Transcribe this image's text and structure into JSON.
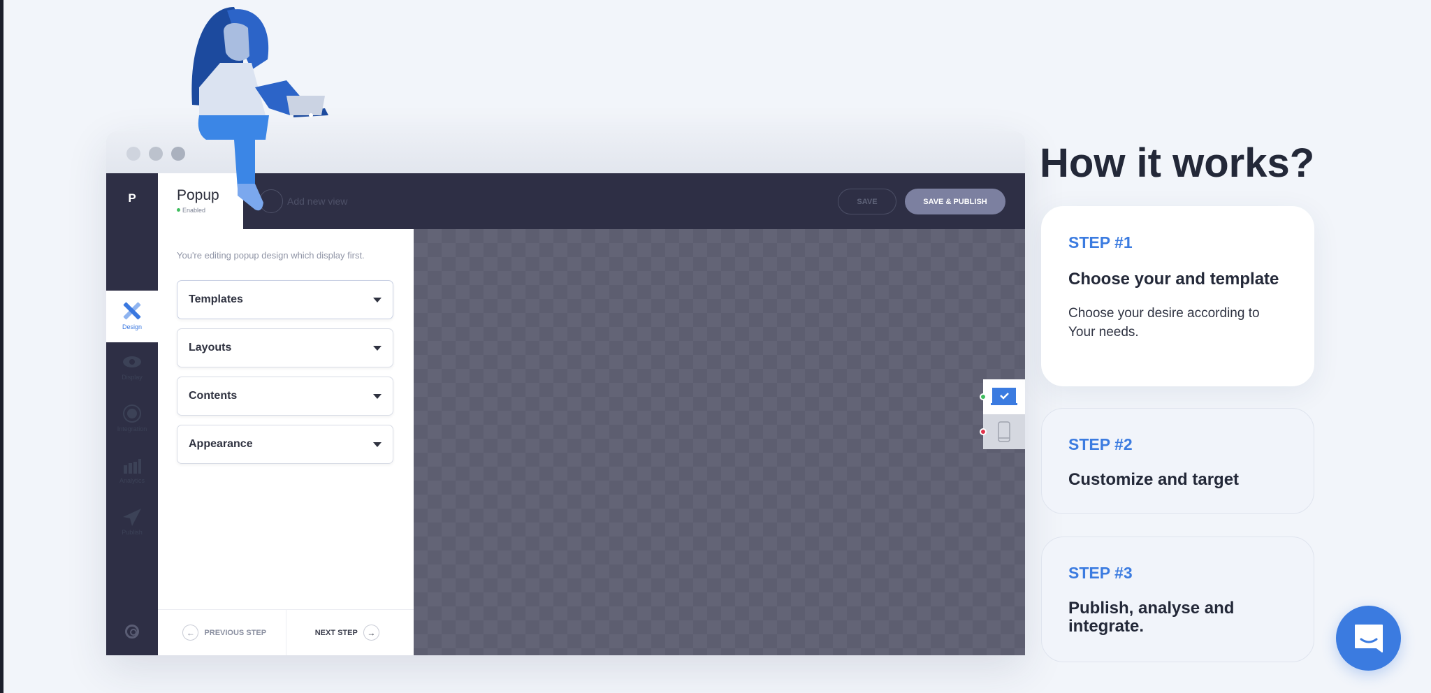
{
  "app": {
    "logo": "P",
    "tab_title": "Popup",
    "tab_status": "Enabled",
    "add_view": "Add new view",
    "save": "SAVE",
    "save_publish": "SAVE & PUBLISH"
  },
  "nav": [
    {
      "label": "Design",
      "icon": "design-icon",
      "active": true
    },
    {
      "label": "Display",
      "icon": "eye-icon"
    },
    {
      "label": "Integration",
      "icon": "integration-icon"
    },
    {
      "label": "Analytics",
      "icon": "analytics-icon"
    },
    {
      "label": "Publish",
      "icon": "paper-plane-icon"
    }
  ],
  "panel": {
    "hint": "You're editing popup design which display first.",
    "sections": [
      "Templates",
      "Layouts",
      "Contents",
      "Appearance"
    ],
    "prev": "PREVIOUS STEP",
    "next": "NEXT STEP"
  },
  "colors": {
    "accent": "#3b7be0",
    "dark": "#2e2f45"
  },
  "hero": {
    "title": "How it works?"
  },
  "steps": [
    {
      "step": "STEP #1",
      "title": "Choose your and template",
      "desc": "Choose your desire according to Your needs."
    },
    {
      "step": "STEP #2",
      "title": "Customize and target"
    },
    {
      "step": "STEP #3",
      "title": "Publish, analyse and integrate."
    }
  ]
}
